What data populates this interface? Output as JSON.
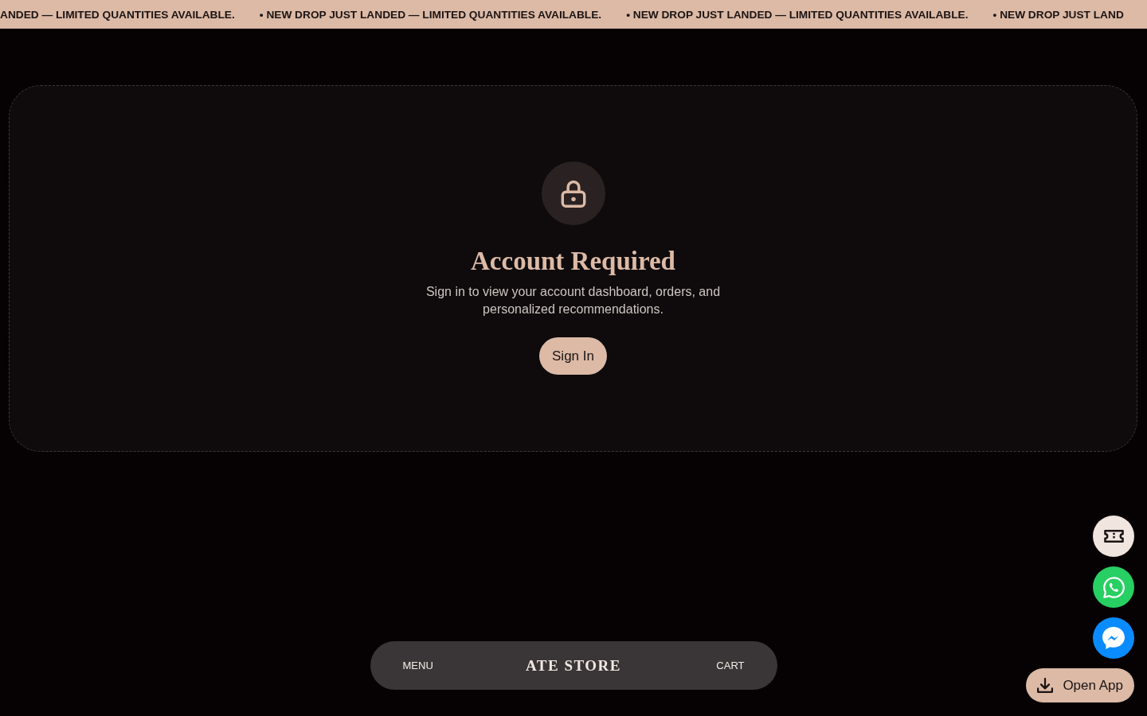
{
  "announcement_bar": {
    "items": [
      "ANDED — LIMITED QUANTITIES AVAILABLE.",
      "• NEW DROP JUST LANDED — LIMITED QUANTITIES AVAILABLE.",
      "• NEW DROP JUST LANDED — LIMITED QUANTITIES AVAILABLE.",
      "• NEW DROP JUST LAND"
    ]
  },
  "account_notice": {
    "title": "Account Required",
    "message": "Sign in to view your account dashboard, orders, and personalized recommendations.",
    "button": "Sign In"
  },
  "bottom_nav": {
    "menu": "MENU",
    "logo": "ATE STORE",
    "cart": "CART"
  },
  "floating_actions": [
    {
      "kind": "ticket"
    },
    {
      "kind": "phone-chat"
    },
    {
      "kind": "bolt-chat"
    }
  ],
  "open_app_button": "Open App"
}
